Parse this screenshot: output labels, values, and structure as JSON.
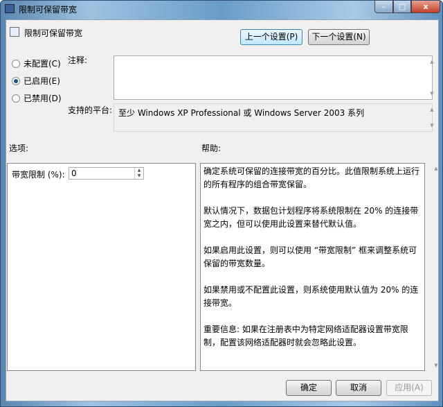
{
  "window": {
    "title": "限制可保留带宽",
    "controls": {
      "minimize": "–",
      "maximize": "□",
      "close": "x"
    }
  },
  "header": {
    "title": "限制可保留带宽",
    "prev_button": "上一个设置(P)",
    "next_button": "下一个设置(N)"
  },
  "state": {
    "options": [
      {
        "label": "未配置(C)",
        "checked": false
      },
      {
        "label": "已启用(E)",
        "checked": true
      },
      {
        "label": "已禁用(D)",
        "checked": false
      }
    ]
  },
  "comment": {
    "label": "注释:",
    "value": ""
  },
  "platform": {
    "label": "支持的平台:",
    "value": "至少 Windows XP Professional 或 Windows Server 2003 系列"
  },
  "options_panel": {
    "label": "选项:",
    "bandwidth_label": "带宽限制 (%):",
    "bandwidth_value": "0"
  },
  "help_panel": {
    "label": "帮助:",
    "paragraphs": [
      "确定系统可保留的连接带宽的百分比。此值限制系统上运行的所有程序的组合带宽保留。",
      "默认情况下，数据包计划程序将系统限制在 20% 的连接带宽之内，但可以使用此设置来替代默认值。",
      "如果启用此设置，则可以使用 “带宽限制” 框来调整系统可保留的带宽数量。",
      "如果禁用或不配置此设置，则系统使用默认值为 20% 的连接带宽。",
      "重要信息: 如果在注册表中为特定网络适配器设置带宽限制，配置该网络适配器时就会忽略此设置。"
    ]
  },
  "footer": {
    "ok": "确定",
    "cancel": "取消",
    "apply": "应用(A)"
  }
}
